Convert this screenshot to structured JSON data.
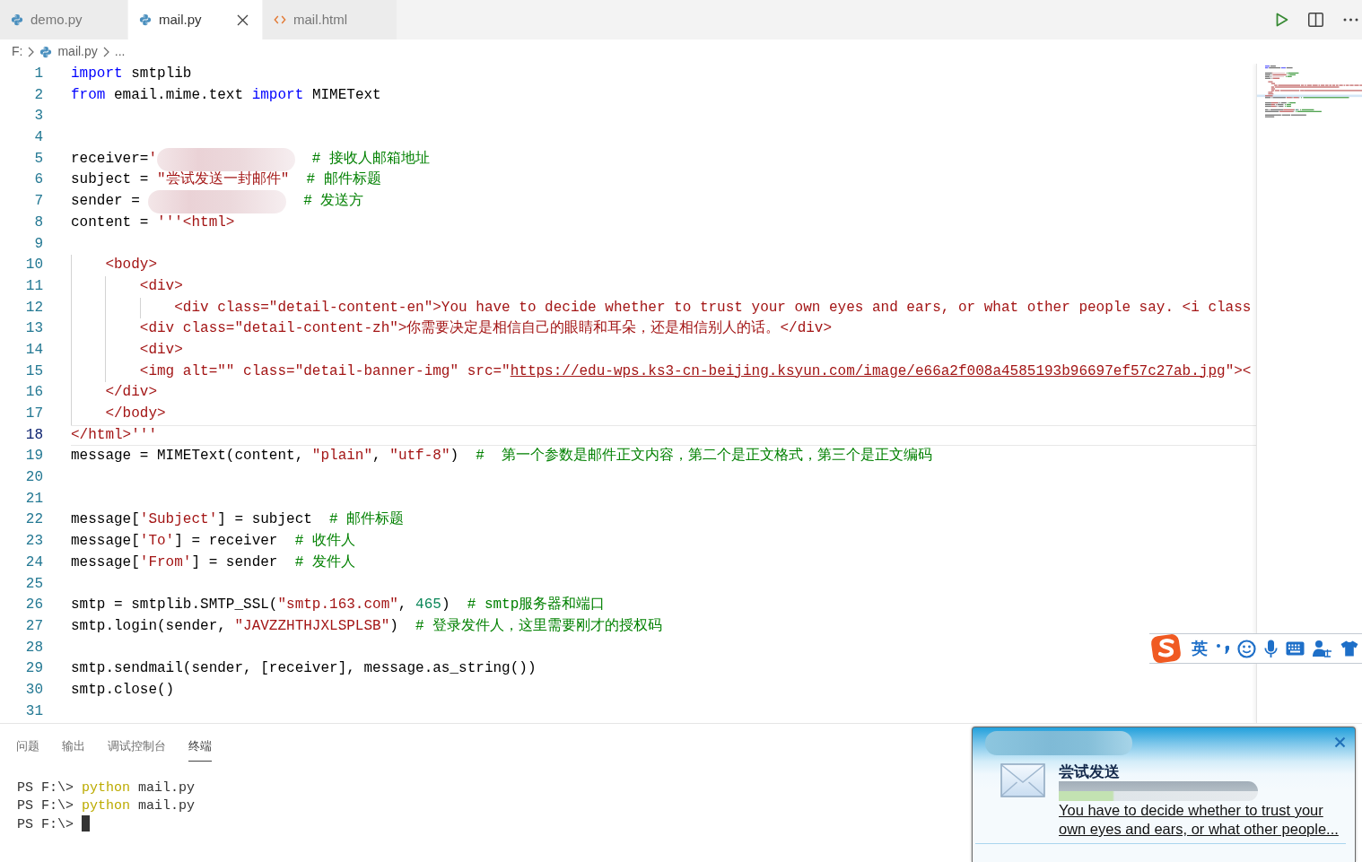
{
  "tabs": [
    {
      "label": "demo.py",
      "kind": "python",
      "selected": false
    },
    {
      "label": "mail.py",
      "kind": "python",
      "selected": true
    },
    {
      "label": "mail.html",
      "kind": "html",
      "selected": false
    }
  ],
  "breadcrumbs": [
    {
      "label": "F:",
      "kind": "drive"
    },
    {
      "label": "mail.py",
      "kind": "python"
    },
    {
      "label": "...",
      "kind": "symbol"
    }
  ],
  "editor": {
    "lines": [
      {
        "number": "1",
        "active": false,
        "tokens": [
          {
            "kind": "keyword",
            "text": "import"
          },
          {
            "kind": "plain",
            "text": " smtplib"
          }
        ]
      },
      {
        "number": "2",
        "active": false,
        "tokens": [
          {
            "kind": "keyword",
            "text": "from"
          },
          {
            "kind": "plain",
            "text": " email.mime.text "
          },
          {
            "kind": "keyword",
            "text": "import"
          },
          {
            "kind": "plain",
            "text": " MIMEText"
          }
        ]
      },
      {
        "number": "3",
        "active": false
      },
      {
        "number": "4",
        "active": false
      },
      {
        "number": "5",
        "active": false,
        "tokens": [
          {
            "kind": "plain",
            "text": "receiver="
          },
          {
            "kind": "string",
            "text": "'"
          },
          {
            "kind": "redacted"
          },
          {
            "kind": "comment",
            "text": "# 接收人邮箱地址"
          }
        ]
      },
      {
        "number": "6",
        "active": false,
        "tokens": [
          {
            "kind": "plain",
            "text": "subject = "
          },
          {
            "kind": "string",
            "text": "\"尝试发送一封邮件\""
          },
          {
            "kind": "comment",
            "text": "  # 邮件标题"
          }
        ]
      },
      {
        "number": "7",
        "active": false,
        "tokens": [
          {
            "kind": "plain",
            "text": "sender = "
          },
          {
            "kind": "redacted"
          },
          {
            "kind": "comment",
            "text": "# 发送方"
          }
        ]
      },
      {
        "number": "8",
        "active": false,
        "tokens": [
          {
            "kind": "plain",
            "text": "content = "
          },
          {
            "kind": "string",
            "text": "'''<html>"
          }
        ]
      },
      {
        "number": "9",
        "active": false
      },
      {
        "number": "10",
        "active": false,
        "tokens": [
          {
            "kind": "string",
            "text": "    <body>"
          }
        ]
      },
      {
        "number": "11",
        "active": false,
        "tokens": [
          {
            "kind": "string",
            "text": "        <div>"
          }
        ]
      },
      {
        "number": "12",
        "active": false,
        "tokens": [
          {
            "kind": "string",
            "text": "            <div class=\"detail-content-en\">You have to decide whether to trust your own eyes and ears, or what other people say. <i class"
          }
        ]
      },
      {
        "number": "13",
        "active": false,
        "tokens": [
          {
            "kind": "string",
            "text": "        <div class=\"detail-content-zh\">你需要决定是相信自己的眼睛和耳朵，还是相信别人的话。</div>"
          }
        ]
      },
      {
        "number": "14",
        "active": false,
        "tokens": [
          {
            "kind": "string",
            "text": "        <div>"
          }
        ]
      },
      {
        "number": "15",
        "active": false,
        "tokens": [
          {
            "kind": "string",
            "text": "        <img alt=\"\" class=\"detail-banner-img\" src=\""
          },
          {
            "kind": "link",
            "text": "https://edu-wps.ks3-cn-beijing.ksyun.com/image/e66a2f008a4585193b96697ef57c27ab.jpg"
          },
          {
            "kind": "string",
            "text": "\"><"
          }
        ]
      },
      {
        "number": "16",
        "active": false,
        "tokens": [
          {
            "kind": "string",
            "text": "    </div>"
          }
        ]
      },
      {
        "number": "17",
        "active": false,
        "tokens": [
          {
            "kind": "string",
            "text": "    </body>"
          }
        ]
      },
      {
        "number": "18",
        "active": true,
        "tokens": [
          {
            "kind": "string",
            "text": "</html>'''"
          }
        ]
      },
      {
        "number": "19",
        "active": false,
        "tokens": [
          {
            "kind": "plain",
            "text": "message = MIMEText(content, "
          },
          {
            "kind": "string",
            "text": "\"plain\""
          },
          {
            "kind": "plain",
            "text": ", "
          },
          {
            "kind": "string",
            "text": "\"utf-8\""
          },
          {
            "kind": "plain",
            "text": ")  "
          },
          {
            "kind": "comment",
            "text": "#  第一个参数是邮件正文内容，第二个是正文格式，第三个是正文编码"
          }
        ]
      },
      {
        "number": "20",
        "active": false
      },
      {
        "number": "21",
        "active": false
      },
      {
        "number": "22",
        "active": false,
        "tokens": [
          {
            "kind": "plain",
            "text": "message["
          },
          {
            "kind": "string",
            "text": "'Subject'"
          },
          {
            "kind": "plain",
            "text": "] = subject  "
          },
          {
            "kind": "comment",
            "text": "# 邮件标题"
          }
        ]
      },
      {
        "number": "23",
        "active": false,
        "tokens": [
          {
            "kind": "plain",
            "text": "message["
          },
          {
            "kind": "string",
            "text": "'To'"
          },
          {
            "kind": "plain",
            "text": "] = receiver  "
          },
          {
            "kind": "comment",
            "text": "# 收件人"
          }
        ]
      },
      {
        "number": "24",
        "active": false,
        "tokens": [
          {
            "kind": "plain",
            "text": "message["
          },
          {
            "kind": "string",
            "text": "'From'"
          },
          {
            "kind": "plain",
            "text": "] = sender  "
          },
          {
            "kind": "comment",
            "text": "# 发件人"
          }
        ]
      },
      {
        "number": "25",
        "active": false
      },
      {
        "number": "26",
        "active": false,
        "tokens": [
          {
            "kind": "plain",
            "text": "smtp = smtplib.SMTP_SSL("
          },
          {
            "kind": "string",
            "text": "\"smtp.163.com\""
          },
          {
            "kind": "plain",
            "text": ", "
          },
          {
            "kind": "number",
            "text": "465"
          },
          {
            "kind": "plain",
            "text": ")  "
          },
          {
            "kind": "comment",
            "text": "# smtp服务器和端口"
          }
        ]
      },
      {
        "number": "27",
        "active": false,
        "tokens": [
          {
            "kind": "plain",
            "text": "smtp.login(sender, "
          },
          {
            "kind": "string",
            "text": "\"JAVZZHTHJXLSPLSB\""
          },
          {
            "kind": "plain",
            "text": ")  "
          },
          {
            "kind": "comment",
            "text": "# 登录发件人，这里需要刚才的授权码"
          }
        ]
      },
      {
        "number": "28",
        "active": false
      },
      {
        "number": "29",
        "active": false,
        "tokens": [
          {
            "kind": "plain",
            "text": "smtp.sendmail(sender, [receiver], message.as_string())"
          }
        ]
      },
      {
        "number": "30",
        "active": false,
        "tokens": [
          {
            "kind": "plain",
            "text": "smtp.close()"
          }
        ]
      },
      {
        "number": "31",
        "active": false
      }
    ]
  },
  "panel": {
    "tabs": [
      {
        "label": "问题",
        "selected": false
      },
      {
        "label": "输出",
        "selected": false
      },
      {
        "label": "调试控制台",
        "selected": false
      },
      {
        "label": "终端",
        "selected": true
      }
    ],
    "terminal": [
      {
        "prompt": "PS F:\\>",
        "command": "python",
        "args": "mail.py"
      },
      {
        "prompt": "PS F:\\>",
        "command": "python",
        "args": "mail.py"
      },
      {
        "prompt": "PS F:\\>"
      }
    ]
  },
  "ime_toolbar": {
    "mode": "英"
  },
  "notification": {
    "title": "尝试发送",
    "message": "You have to decide whether to trust your own eyes and ears, or what other people..."
  }
}
